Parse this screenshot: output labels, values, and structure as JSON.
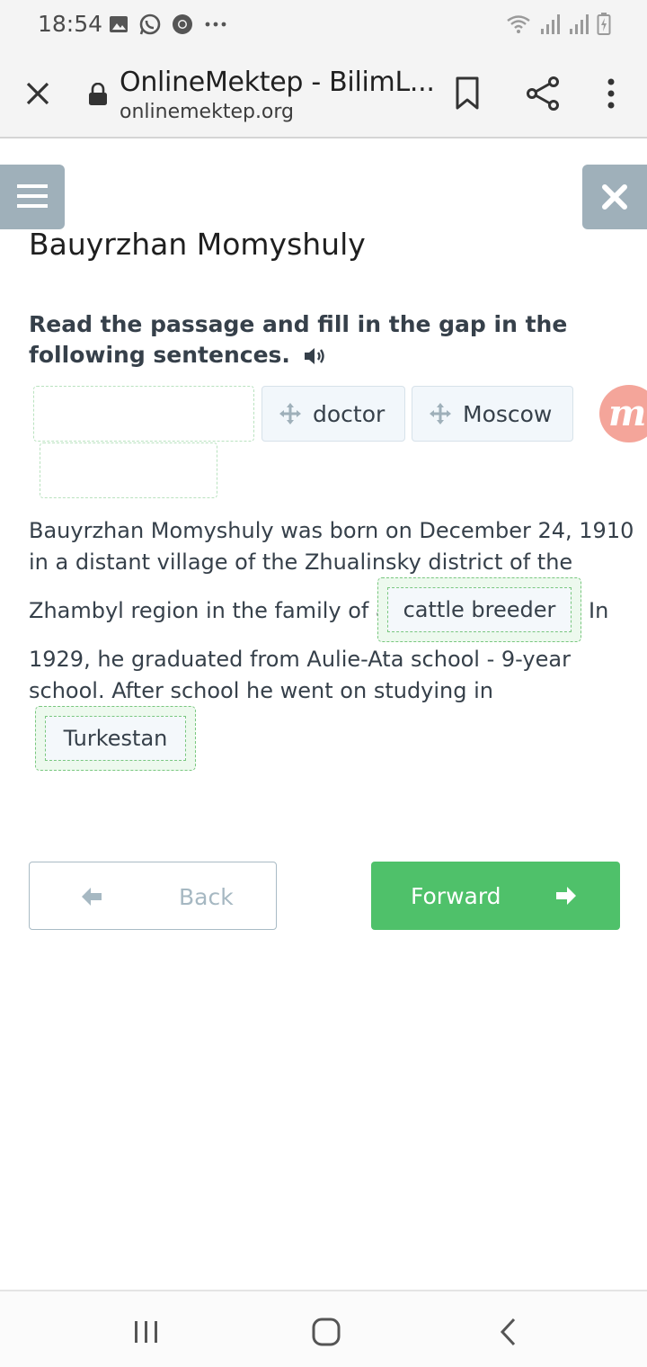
{
  "status_bar": {
    "time": "18:54",
    "icons_left": [
      "image-icon",
      "whatsapp-icon",
      "chrome-icon",
      "more-dots-icon"
    ],
    "icons_right": [
      "wifi-icon",
      "signal-icon",
      "signal-icon",
      "battery-charging-icon"
    ]
  },
  "browser": {
    "title": "OnlineMektep - BilimL...",
    "url": "onlinemektep.org"
  },
  "page": {
    "title": "Bauyrzhan Momyshuly",
    "instruction": "Read the passage and fill in the gap in the following sentences."
  },
  "word_bank": {
    "chips": [
      {
        "label": "doctor"
      },
      {
        "label": "Moscow"
      }
    ],
    "badge_letter": "m"
  },
  "passage": {
    "line1": "Bauyrzhan Momyshuly was born on December 24, 1910",
    "line2": "in a distant village of the Zhualinsky district of the",
    "line3_before": "Zhambyl region in the family of a",
    "gap1": "cattle breeder",
    "line3_after": "In",
    "line4": "1929, he graduated from Aulie-Ata school - 9-year",
    "line5": "school. After school he went on studying in",
    "gap2": "Turkestan"
  },
  "navigation": {
    "back_label": "Back",
    "forward_label": "Forward"
  },
  "colors": {
    "accent_green": "#4fc16a",
    "side_button": "#9fb0ba",
    "badge_orange": "#f4a59a",
    "gap_border": "#79c77f"
  }
}
